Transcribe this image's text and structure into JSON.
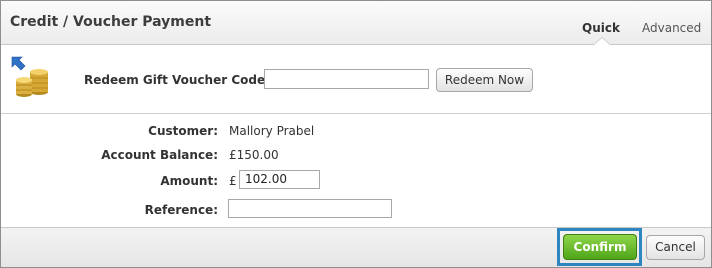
{
  "header": {
    "title": "Credit / Voucher Payment",
    "tabs": [
      {
        "label": "Quick",
        "active": true
      },
      {
        "label": "Advanced",
        "active": false
      }
    ]
  },
  "voucher": {
    "icon": "coins-icon",
    "label": "Redeem Gift Voucher Code:",
    "input_value": "",
    "redeem_label": "Redeem Now"
  },
  "form": {
    "customer_label": "Customer:",
    "customer_value": "Mallory Prabel",
    "balance_label": "Account Balance:",
    "balance_value": "£150.00",
    "amount_label": "Amount:",
    "currency_symbol": "£",
    "amount_value": "102.00",
    "reference_label": "Reference:",
    "reference_value": ""
  },
  "footer": {
    "confirm_label": "Confirm",
    "cancel_label": "Cancel"
  },
  "colors": {
    "confirm_green": "#5cb324",
    "highlight_blue": "#2e86c1"
  }
}
